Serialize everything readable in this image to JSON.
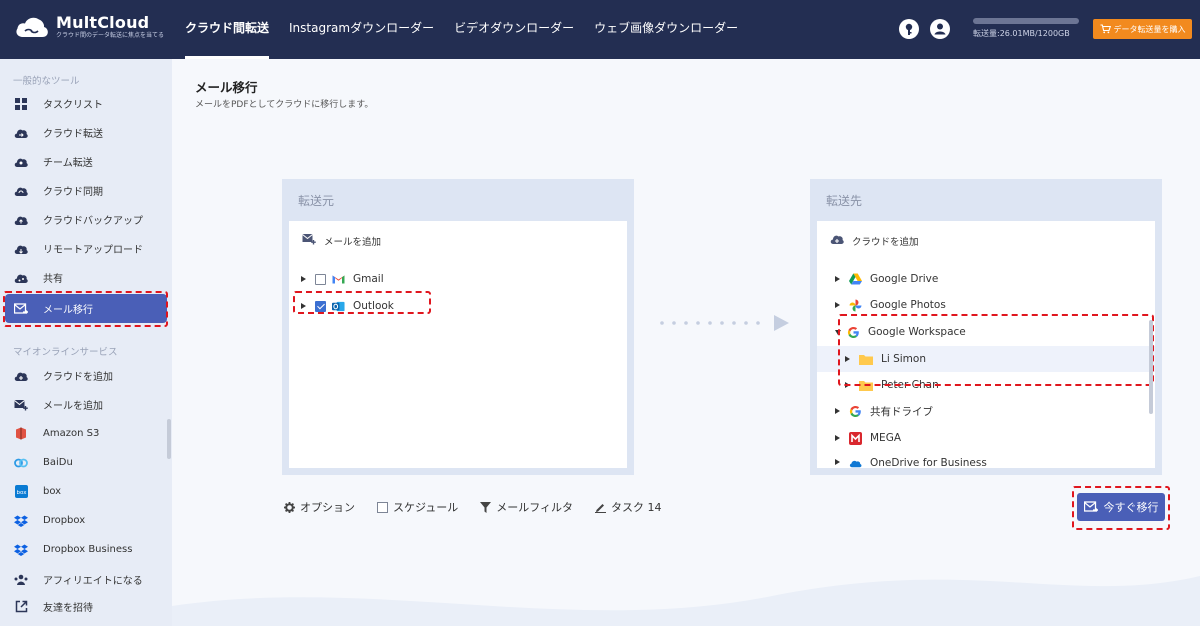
{
  "app": {
    "name": "MultCloud",
    "tagline": "クラウド間のデータ転送に焦点を当てる"
  },
  "nav": {
    "tabs": [
      "クラウド間転送",
      "Instagramダウンローダー",
      "ビデオダウンローダー",
      "ウェブ画像ダウンローダー"
    ],
    "active_index": 0
  },
  "header": {
    "usage_text": "転送量:26.01MB/1200GB",
    "usage_fraction": 2e-05,
    "buy_label": "データ転送量を購入",
    "buy_color": "#f28a1e"
  },
  "sidebar": {
    "section1": "一般的なツール",
    "tools": [
      {
        "label": "タスクリスト",
        "icon": "grid-icon"
      },
      {
        "label": "クラウド転送",
        "icon": "cloud-transfer-icon"
      },
      {
        "label": "チーム転送",
        "icon": "team-transfer-icon"
      },
      {
        "label": "クラウド同期",
        "icon": "cloud-sync-icon"
      },
      {
        "label": "クラウドバックアップ",
        "icon": "cloud-backup-icon"
      },
      {
        "label": "リモートアップロード",
        "icon": "remote-upload-icon"
      },
      {
        "label": "共有",
        "icon": "share-icon"
      },
      {
        "label": "メール移行",
        "icon": "email-migration-icon",
        "active": true
      }
    ],
    "section2": "マイオンラインサービス",
    "services": [
      {
        "label": "クラウドを追加",
        "icon": "add-cloud-icon"
      },
      {
        "label": "メールを追加",
        "icon": "add-email-icon"
      },
      {
        "label": "Amazon S3",
        "icon": "amazon-s3-icon"
      },
      {
        "label": "BaiDu",
        "icon": "baidu-icon"
      },
      {
        "label": "box",
        "icon": "box-icon"
      },
      {
        "label": "Dropbox",
        "icon": "dropbox-icon"
      },
      {
        "label": "Dropbox Business",
        "icon": "dropbox-business-icon"
      },
      {
        "label": "アフィリエイトになる",
        "icon": "affiliate-icon"
      },
      {
        "label": "友達を招待",
        "icon": "invite-icon"
      }
    ],
    "accent": "#4a5fb7"
  },
  "main": {
    "title": "メール移行",
    "description": "メールをPDFとしてクラウドに移行します。",
    "source": {
      "heading": "転送元",
      "add_label": "メールを追加",
      "items": [
        {
          "label": "Gmail",
          "checked": false
        },
        {
          "label": "Outlook",
          "checked": true
        }
      ]
    },
    "destination": {
      "heading": "転送先",
      "add_label": "クラウドを追加",
      "items": [
        {
          "label": "Google Drive"
        },
        {
          "label": "Google Photos"
        },
        {
          "label": "Google Workspace",
          "expanded": true
        },
        {
          "label": "Li Simon",
          "child": true,
          "selected": true
        },
        {
          "label": "Peter Chan",
          "child": true
        },
        {
          "label": "共有ドライブ"
        },
        {
          "label": "MEGA"
        },
        {
          "label": "OneDrive for Business"
        }
      ]
    },
    "toolbar": {
      "options": "オプション",
      "schedule": "スケジュール",
      "filter": "メールフィルタ",
      "task": "タスク 14"
    },
    "go_label": "今すぐ移行"
  }
}
